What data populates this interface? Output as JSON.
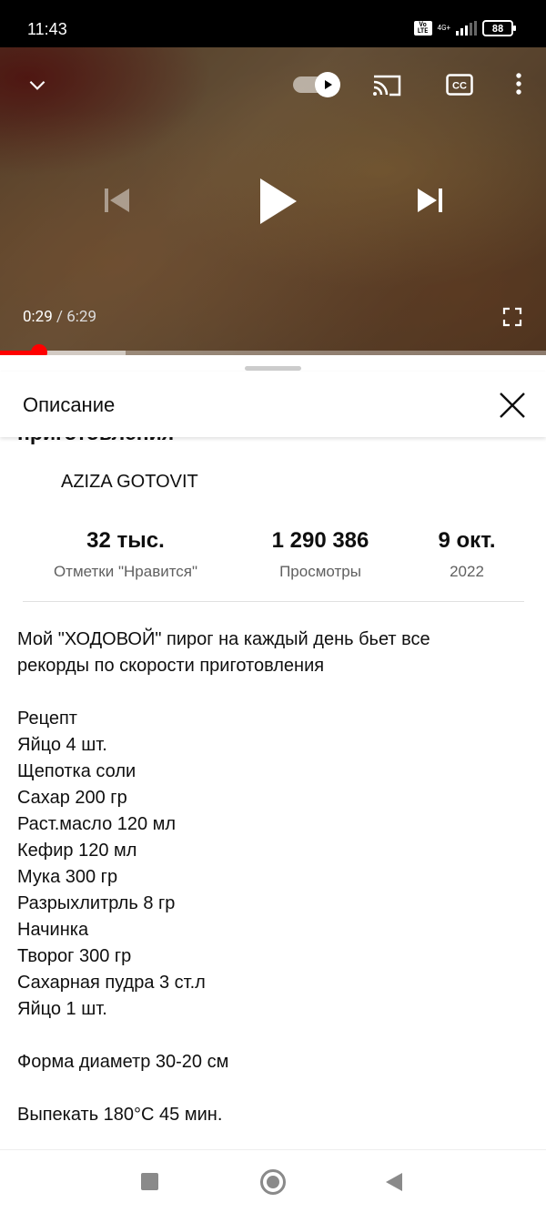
{
  "status_bar": {
    "time": "11:43",
    "volte_label": "Vo LTE",
    "network_label": "4G+",
    "battery": "88"
  },
  "player": {
    "current_time": "0:29",
    "separator": " / ",
    "duration": "6:29",
    "progress_fraction": 0.074,
    "buffered_fraction": 0.23,
    "icons": [
      "chevron-down-icon",
      "autoplay-toggle",
      "cast-icon",
      "cc-icon",
      "more-vert-icon",
      "skip-previous-icon",
      "play-icon",
      "skip-next-icon",
      "fullscreen-icon"
    ],
    "accent_color": "#ff0000"
  },
  "sheet": {
    "title": "Описание",
    "video_title_cut": "приготовления",
    "channel": "AZIZA GOTOVIT",
    "stats": {
      "likes_value": "32 тыс.",
      "likes_label": "Отметки \"Нравится\"",
      "views_value": "1 290 386",
      "views_label": "Просмотры",
      "date_value": "9 окт.",
      "date_year": "2022"
    },
    "description_lines": [
      "Мой \"ХОДОВОЙ\" пирог на каждый день бьет все",
      "рекорды по скорости приготовления",
      "",
      "Рецепт",
      "Яйцо 4 шт.",
      "Щепотка соли",
      "Сахар 200 гр",
      "Раст.масло 120 мл",
      "Кефир 120 мл",
      "Мука 300 гр",
      "Разрыхлитрль 8 гр",
      "Начинка",
      "Творог 300 гр",
      "Сахарная пудра 3 ст.л",
      "Яйцо 1 шт.",
      "",
      "Форма диаметр 30-20 см",
      "",
      "Выпекать 180°C 45 мин."
    ]
  }
}
